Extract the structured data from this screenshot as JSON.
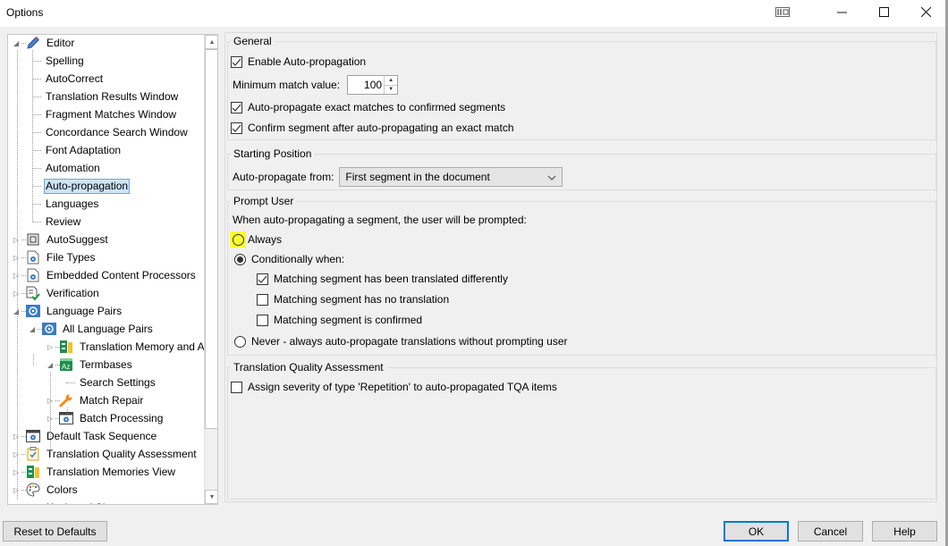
{
  "window": {
    "title": "Options",
    "controls": {
      "tab_mode": "tab-mode-icon",
      "minimize": "minimize-icon",
      "maximize": "maximize-icon",
      "close": "close-icon"
    }
  },
  "tree": {
    "items": [
      {
        "label": "Editor",
        "level": 0,
        "expander": "expanded",
        "icon": "pencil-icon"
      },
      {
        "label": "Spelling",
        "level": 1
      },
      {
        "label": "AutoCorrect",
        "level": 1
      },
      {
        "label": "Translation Results Window",
        "level": 1
      },
      {
        "label": "Fragment Matches Window",
        "level": 1
      },
      {
        "label": "Concordance Search Window",
        "level": 1
      },
      {
        "label": "Font Adaptation",
        "level": 1
      },
      {
        "label": "Automation",
        "level": 1
      },
      {
        "label": "Auto-propagation",
        "level": 1,
        "selected": true
      },
      {
        "label": "Languages",
        "level": 1
      },
      {
        "label": "Review",
        "level": 1
      },
      {
        "label": "AutoSuggest",
        "level": 0,
        "expander": "collapsed",
        "icon": "autosuggest-icon"
      },
      {
        "label": "File Types",
        "level": 0,
        "expander": "collapsed",
        "icon": "file-gear-icon"
      },
      {
        "label": "Embedded Content Processors",
        "level": 0,
        "expander": "collapsed",
        "icon": "file-gear-icon"
      },
      {
        "label": "Verification",
        "level": 0,
        "expander": "collapsed",
        "icon": "verification-icon"
      },
      {
        "label": "Language Pairs",
        "level": 0,
        "expander": "expanded",
        "icon": "language-pairs-icon"
      },
      {
        "label": "All Language Pairs",
        "level": 1,
        "expander": "expanded",
        "icon": "language-pairs-icon"
      },
      {
        "label": "Translation Memory and A",
        "level": 2,
        "expander": "collapsed",
        "icon": "translation-memory-icon"
      },
      {
        "label": "Termbases",
        "level": 2,
        "expander": "expanded",
        "icon": "termbase-icon"
      },
      {
        "label": "Search Settings",
        "level": 3
      },
      {
        "label": "Match Repair",
        "level": 2,
        "expander": "collapsed",
        "icon": "wrench-icon"
      },
      {
        "label": "Batch Processing",
        "level": 2,
        "expander": "collapsed",
        "icon": "window-gear-icon"
      },
      {
        "label": "Default Task Sequence",
        "level": 0,
        "expander": "collapsed",
        "icon": "window-gear-icon"
      },
      {
        "label": "Translation Quality Assessment",
        "level": 0,
        "expander": "collapsed",
        "icon": "clipboard-check-icon"
      },
      {
        "label": "Translation Memories View",
        "level": 0,
        "expander": "collapsed",
        "icon": "translation-memory-icon"
      },
      {
        "label": "Colors",
        "level": 0,
        "expander": "collapsed",
        "icon": "palette-icon"
      },
      {
        "label": "Keyboard Shortcuts",
        "level": 0,
        "expander": "collapsed",
        "icon": "keyboard-icon"
      }
    ]
  },
  "general": {
    "legend": "General",
    "enable_autoprop": {
      "label": "Enable Auto-propagation",
      "checked": true
    },
    "min_match": {
      "label": "Minimum match value:",
      "value": "100"
    },
    "exact_to_confirmed": {
      "label": "Auto-propagate exact matches to confirmed segments",
      "checked": true
    },
    "confirm_after": {
      "label": "Confirm segment after auto-propagating an exact match",
      "checked": true
    }
  },
  "starting_position": {
    "legend": "Starting Position",
    "from_label": "Auto-propagate from:",
    "from_value": "First segment in the document"
  },
  "prompt_user": {
    "legend": "Prompt User",
    "intro": "When auto-propagating a segment, the user will be prompted:",
    "always": {
      "label": "Always",
      "selected": false,
      "highlight_color": "#ffff33"
    },
    "conditionally": {
      "label": "Conditionally when:",
      "selected": true
    },
    "cond_translated_differently": {
      "label": "Matching segment has been translated differently",
      "checked": true
    },
    "cond_no_translation": {
      "label": "Matching segment has no translation",
      "checked": false
    },
    "cond_confirmed": {
      "label": "Matching segment is confirmed",
      "checked": false
    },
    "never": {
      "label": "Never - always auto-propagate translations without prompting user",
      "selected": false
    }
  },
  "tqa": {
    "legend": "Translation Quality Assessment",
    "assign_severity": {
      "label": "Assign severity of type 'Repetition' to auto-propagated TQA items",
      "checked": false
    }
  },
  "buttons": {
    "reset": "Reset to Defaults",
    "ok": "OK",
    "cancel": "Cancel",
    "help": "Help"
  },
  "colors": {
    "selection_bg": "#cce4f7",
    "selection_border": "#6aa8dc",
    "default_button_border": "#0078d7",
    "highlight": "#ffff33"
  }
}
